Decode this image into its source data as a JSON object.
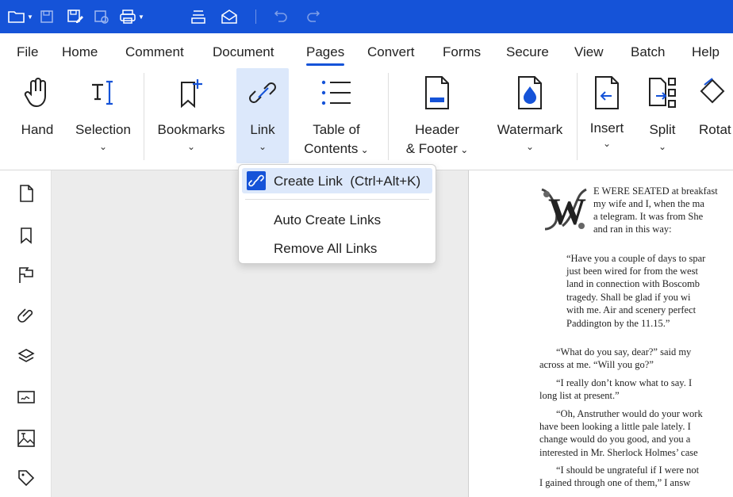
{
  "menu": {
    "items": [
      "File",
      "Home",
      "Comment",
      "Document",
      "Pages",
      "Convert",
      "Forms",
      "Secure",
      "View",
      "Batch",
      "Help"
    ],
    "active": "Pages"
  },
  "ribbon": {
    "hand": "Hand",
    "selection": "Selection",
    "bookmarks": "Bookmarks",
    "link": "Link",
    "toc_line1": "Table of",
    "toc_line2": "Contents",
    "header_line1": "Header",
    "header_line2": "& Footer",
    "watermark": "Watermark",
    "insert": "Insert",
    "split": "Split",
    "rotate": "Rotat"
  },
  "dropdown": {
    "create_link": "Create Link",
    "create_link_shortcut": "(Ctrl+Alt+K)",
    "auto_create": "Auto Create Links",
    "remove_all": "Remove All Links"
  },
  "document": {
    "para1": [
      "E WERE SEATED at breakfast",
      "my wife and I, when the ma",
      "a telegram. It was from She",
      "and ran in this way:"
    ],
    "quote": [
      "“Have you a couple of days to spar",
      "just been wired for from the west",
      "land in connection with Boscomb",
      "tragedy.  Shall be glad if you wi",
      "with me.  Air and scenery perfect",
      "Paddington by the 11.15.”"
    ],
    "para2": [
      "“What do you say, dear?” said my",
      "across at me. “Will you go?”"
    ],
    "para3": [
      "“I really don’t know what to say. I",
      "long list at present.”"
    ],
    "para4": [
      "“Oh, Anstruther would do your work",
      "have been looking a little pale lately. I",
      "change would do you good, and you a",
      "interested in Mr. Sherlock Holmes’ case"
    ],
    "para5": [
      "“I should be ungrateful if I were not",
      "I gained through one of them,” I answ"
    ]
  },
  "colors": {
    "titlebar": "#1553d8",
    "accent": "#1553d8",
    "selected": "#dce8fb",
    "canvas": "#ececec"
  }
}
